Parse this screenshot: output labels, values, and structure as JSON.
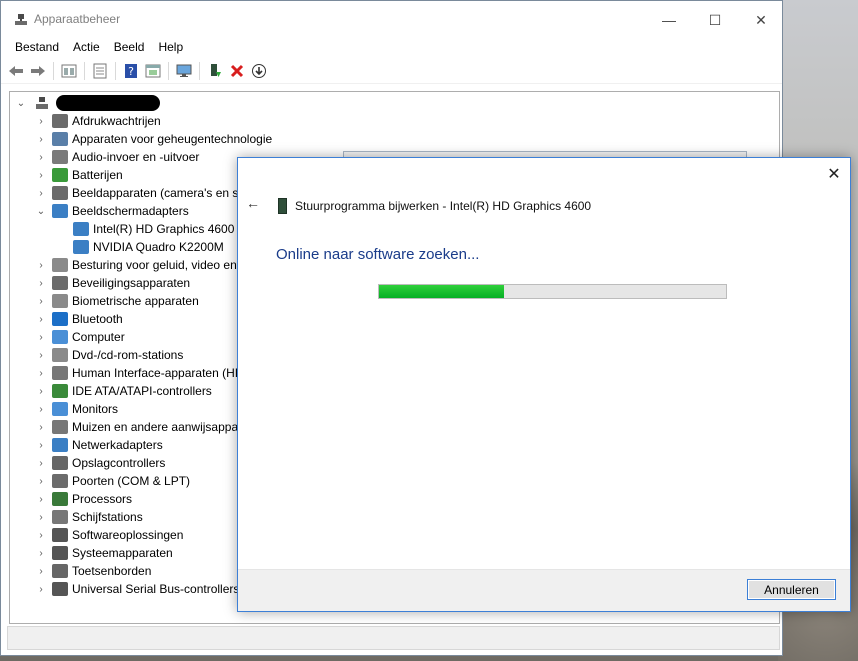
{
  "window": {
    "title": "Apparaatbeheer",
    "controls": {
      "minimize": "—",
      "maximize": "☐",
      "close": "✕"
    }
  },
  "menu": [
    "Bestand",
    "Actie",
    "Beeld",
    "Help"
  ],
  "toolbar": {
    "icons": [
      "back-icon",
      "forward-icon",
      "properties-icon",
      "view-icon",
      "help-icon",
      "resource-icon",
      "monitor-icon",
      "update-driver-icon",
      "uninstall-icon",
      "scan-icon"
    ]
  },
  "tree": {
    "root_label": "",
    "items": [
      {
        "label": "Afdrukwachtrijen",
        "expanded": false
      },
      {
        "label": "Apparaten voor geheugentechnologie",
        "expanded": false
      },
      {
        "label": "Audio-invoer en -uitvoer",
        "expanded": false
      },
      {
        "label": "Batterijen",
        "expanded": false
      },
      {
        "label": "Beeldapparaten (camera's en sc",
        "expanded": false
      },
      {
        "label": "Beeldschermadapters",
        "expanded": true
      },
      {
        "label": "Intel(R) HD Graphics 4600",
        "child": true
      },
      {
        "label": "NVIDIA Quadro K2200M",
        "child": true
      },
      {
        "label": "Besturing voor geluid, video en",
        "expanded": false
      },
      {
        "label": "Beveiligingsapparaten",
        "expanded": false
      },
      {
        "label": "Biometrische apparaten",
        "expanded": false
      },
      {
        "label": "Bluetooth",
        "expanded": false
      },
      {
        "label": "Computer",
        "expanded": false
      },
      {
        "label": "Dvd-/cd-rom-stations",
        "expanded": false
      },
      {
        "label": "Human Interface-apparaten (HI",
        "expanded": false
      },
      {
        "label": "IDE ATA/ATAPI-controllers",
        "expanded": false
      },
      {
        "label": "Monitors",
        "expanded": false
      },
      {
        "label": "Muizen en andere aanwijsappar",
        "expanded": false
      },
      {
        "label": "Netwerkadapters",
        "expanded": false
      },
      {
        "label": "Opslagcontrollers",
        "expanded": false
      },
      {
        "label": "Poorten (COM & LPT)",
        "expanded": false
      },
      {
        "label": "Processors",
        "expanded": false
      },
      {
        "label": "Schijfstations",
        "expanded": false
      },
      {
        "label": "Softwareoplossingen",
        "expanded": false
      },
      {
        "label": "Systeemapparaten",
        "expanded": false
      },
      {
        "label": "Toetsenborden",
        "expanded": false
      },
      {
        "label": "Universal Serial Bus-controllers",
        "expanded": false
      }
    ]
  },
  "dialog": {
    "header": "Stuurprogramma bijwerken - Intel(R) HD Graphics 4600",
    "status": "Online naar software zoeken...",
    "progress_fraction": 0.36,
    "cancel_label": "Annuleren",
    "close": "✕",
    "back": "←"
  },
  "colors": {
    "progress_green": "#06b025",
    "heading_blue": "#1a3c8a",
    "accent_border": "#3c7fd6"
  }
}
